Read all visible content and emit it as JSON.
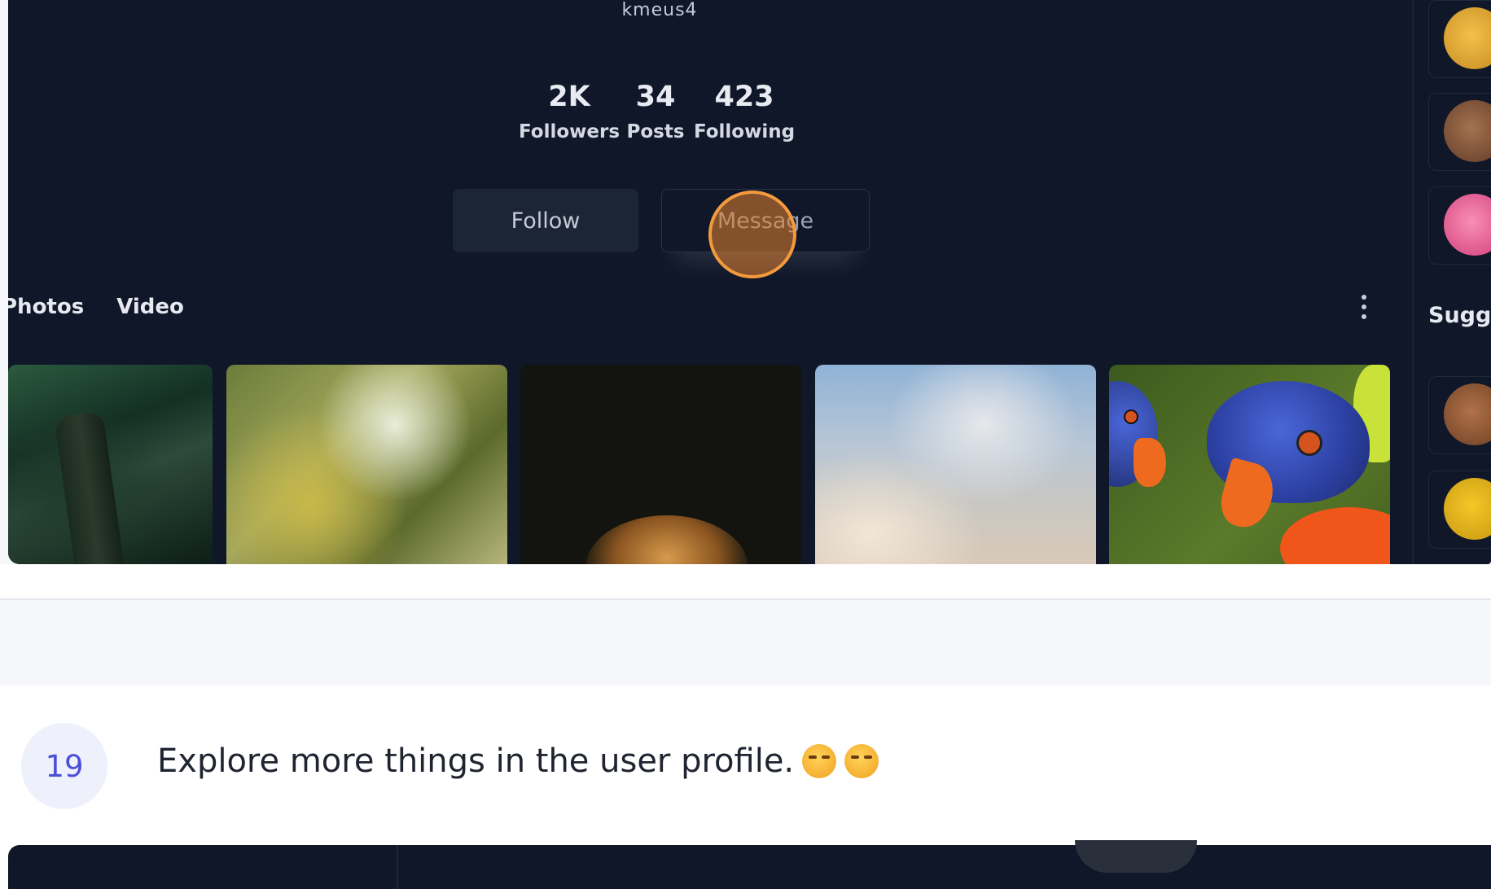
{
  "profile": {
    "username": "kmeus4",
    "stats": [
      {
        "value": "2K",
        "label": "Followers"
      },
      {
        "value": "34",
        "label": "Posts"
      },
      {
        "value": "423",
        "label": "Following"
      }
    ],
    "follow_label": "Follow",
    "message_label": "Message",
    "tabs": [
      "Photos",
      "Video"
    ],
    "photos": [
      "forest-trees",
      "tree-canopy",
      "dark-plant",
      "cloudy-sky",
      "parrots"
    ]
  },
  "sidebar": {
    "suggest_label": "Sugge",
    "avatars": [
      "cat-avatar-yellow",
      "cat-avatar-brown",
      "cat-avatar-pink",
      "cat-avatar-brown-2",
      "cat-avatar-yellow-2"
    ]
  },
  "step": {
    "number": "19",
    "text": "Explore more things in the user profile."
  },
  "colors": {
    "card_bg": "#0f1729",
    "click_ring": "#f39a3c",
    "step_accent": "#4b4fd6"
  }
}
